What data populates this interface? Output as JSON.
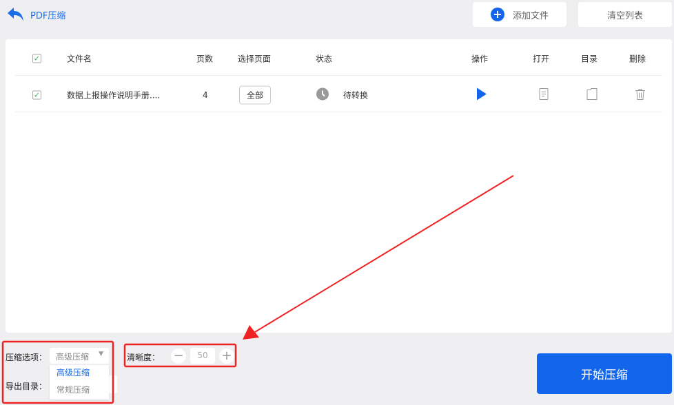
{
  "header": {
    "title": "PDF压缩",
    "add_file": "添加文件",
    "clear_list": "清空列表"
  },
  "table": {
    "columns": [
      "文件名",
      "页数",
      "选择页面",
      "状态",
      "操作",
      "打开",
      "目录",
      "删除"
    ],
    "rows": [
      {
        "name": "数据上报操作说明手册....",
        "pages": "4",
        "page_select": "全部",
        "status": "待转换"
      }
    ]
  },
  "options": {
    "compress_label": "压缩选项：",
    "compress_value": "高级压缩",
    "compress_options": [
      "高级压缩",
      "常规压缩"
    ],
    "export_label": "导出目录：",
    "clarity_label": "清晰度：",
    "clarity_value": "50"
  },
  "start_button": "开始压缩",
  "colors": {
    "accent": "#1366ec",
    "annotation": "#ee2222"
  }
}
